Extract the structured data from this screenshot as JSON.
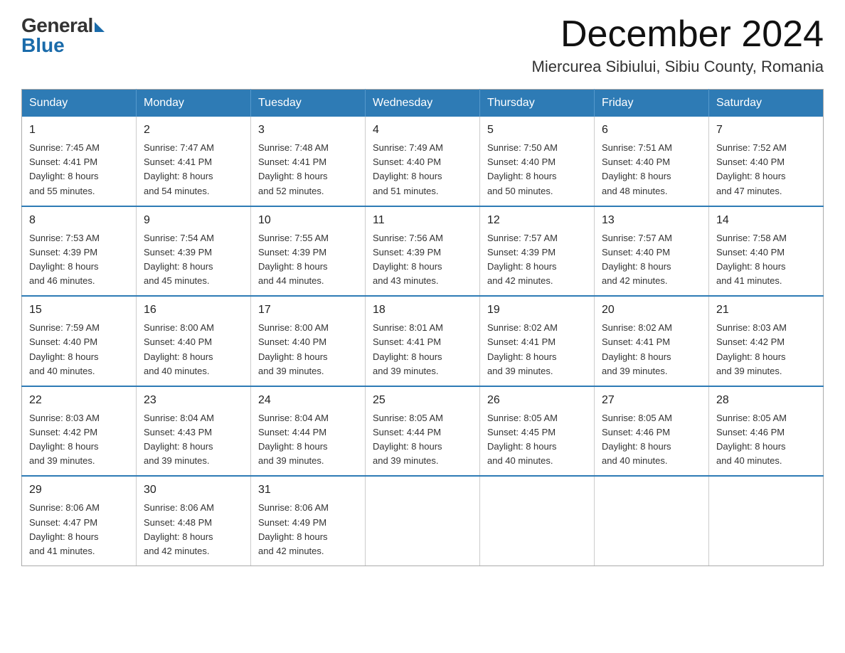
{
  "logo": {
    "general": "General",
    "blue": "Blue"
  },
  "header": {
    "month": "December 2024",
    "location": "Miercurea Sibiului, Sibiu County, Romania"
  },
  "weekdays": [
    "Sunday",
    "Monday",
    "Tuesday",
    "Wednesday",
    "Thursday",
    "Friday",
    "Saturday"
  ],
  "weeks": [
    [
      {
        "day": "1",
        "sunrise": "7:45 AM",
        "sunset": "4:41 PM",
        "daylight": "8 hours and 55 minutes."
      },
      {
        "day": "2",
        "sunrise": "7:47 AM",
        "sunset": "4:41 PM",
        "daylight": "8 hours and 54 minutes."
      },
      {
        "day": "3",
        "sunrise": "7:48 AM",
        "sunset": "4:41 PM",
        "daylight": "8 hours and 52 minutes."
      },
      {
        "day": "4",
        "sunrise": "7:49 AM",
        "sunset": "4:40 PM",
        "daylight": "8 hours and 51 minutes."
      },
      {
        "day": "5",
        "sunrise": "7:50 AM",
        "sunset": "4:40 PM",
        "daylight": "8 hours and 50 minutes."
      },
      {
        "day": "6",
        "sunrise": "7:51 AM",
        "sunset": "4:40 PM",
        "daylight": "8 hours and 48 minutes."
      },
      {
        "day": "7",
        "sunrise": "7:52 AM",
        "sunset": "4:40 PM",
        "daylight": "8 hours and 47 minutes."
      }
    ],
    [
      {
        "day": "8",
        "sunrise": "7:53 AM",
        "sunset": "4:39 PM",
        "daylight": "8 hours and 46 minutes."
      },
      {
        "day": "9",
        "sunrise": "7:54 AM",
        "sunset": "4:39 PM",
        "daylight": "8 hours and 45 minutes."
      },
      {
        "day": "10",
        "sunrise": "7:55 AM",
        "sunset": "4:39 PM",
        "daylight": "8 hours and 44 minutes."
      },
      {
        "day": "11",
        "sunrise": "7:56 AM",
        "sunset": "4:39 PM",
        "daylight": "8 hours and 43 minutes."
      },
      {
        "day": "12",
        "sunrise": "7:57 AM",
        "sunset": "4:39 PM",
        "daylight": "8 hours and 42 minutes."
      },
      {
        "day": "13",
        "sunrise": "7:57 AM",
        "sunset": "4:40 PM",
        "daylight": "8 hours and 42 minutes."
      },
      {
        "day": "14",
        "sunrise": "7:58 AM",
        "sunset": "4:40 PM",
        "daylight": "8 hours and 41 minutes."
      }
    ],
    [
      {
        "day": "15",
        "sunrise": "7:59 AM",
        "sunset": "4:40 PM",
        "daylight": "8 hours and 40 minutes."
      },
      {
        "day": "16",
        "sunrise": "8:00 AM",
        "sunset": "4:40 PM",
        "daylight": "8 hours and 40 minutes."
      },
      {
        "day": "17",
        "sunrise": "8:00 AM",
        "sunset": "4:40 PM",
        "daylight": "8 hours and 39 minutes."
      },
      {
        "day": "18",
        "sunrise": "8:01 AM",
        "sunset": "4:41 PM",
        "daylight": "8 hours and 39 minutes."
      },
      {
        "day": "19",
        "sunrise": "8:02 AM",
        "sunset": "4:41 PM",
        "daylight": "8 hours and 39 minutes."
      },
      {
        "day": "20",
        "sunrise": "8:02 AM",
        "sunset": "4:41 PM",
        "daylight": "8 hours and 39 minutes."
      },
      {
        "day": "21",
        "sunrise": "8:03 AM",
        "sunset": "4:42 PM",
        "daylight": "8 hours and 39 minutes."
      }
    ],
    [
      {
        "day": "22",
        "sunrise": "8:03 AM",
        "sunset": "4:42 PM",
        "daylight": "8 hours and 39 minutes."
      },
      {
        "day": "23",
        "sunrise": "8:04 AM",
        "sunset": "4:43 PM",
        "daylight": "8 hours and 39 minutes."
      },
      {
        "day": "24",
        "sunrise": "8:04 AM",
        "sunset": "4:44 PM",
        "daylight": "8 hours and 39 minutes."
      },
      {
        "day": "25",
        "sunrise": "8:05 AM",
        "sunset": "4:44 PM",
        "daylight": "8 hours and 39 minutes."
      },
      {
        "day": "26",
        "sunrise": "8:05 AM",
        "sunset": "4:45 PM",
        "daylight": "8 hours and 40 minutes."
      },
      {
        "day": "27",
        "sunrise": "8:05 AM",
        "sunset": "4:46 PM",
        "daylight": "8 hours and 40 minutes."
      },
      {
        "day": "28",
        "sunrise": "8:05 AM",
        "sunset": "4:46 PM",
        "daylight": "8 hours and 40 minutes."
      }
    ],
    [
      {
        "day": "29",
        "sunrise": "8:06 AM",
        "sunset": "4:47 PM",
        "daylight": "8 hours and 41 minutes."
      },
      {
        "day": "30",
        "sunrise": "8:06 AM",
        "sunset": "4:48 PM",
        "daylight": "8 hours and 42 minutes."
      },
      {
        "day": "31",
        "sunrise": "8:06 AM",
        "sunset": "4:49 PM",
        "daylight": "8 hours and 42 minutes."
      },
      null,
      null,
      null,
      null
    ]
  ],
  "labels": {
    "sunrise": "Sunrise:",
    "sunset": "Sunset:",
    "daylight": "Daylight:"
  }
}
